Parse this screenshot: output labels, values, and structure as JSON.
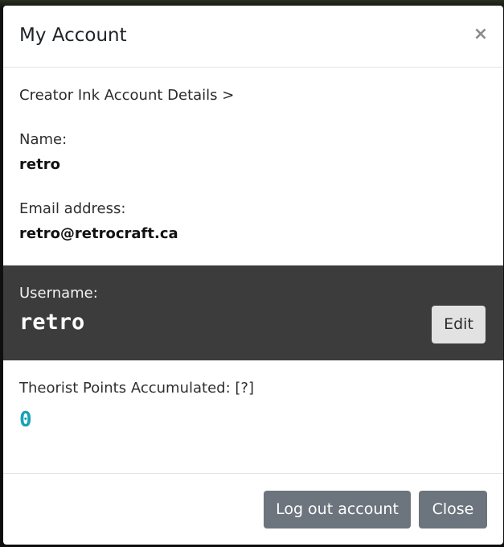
{
  "modal": {
    "title": "My Account",
    "close_icon": "×"
  },
  "details_link": "Creator Ink Account Details >",
  "fields": {
    "name_label": "Name:",
    "name_value": "retro",
    "email_label": "Email address:",
    "email_value": "retro@retrocraft.ca"
  },
  "username": {
    "label": "Username:",
    "value": "retro",
    "edit_label": "Edit"
  },
  "points": {
    "label": "Theorist Points Accumulated:",
    "help": "[?]",
    "value": "0"
  },
  "footer": {
    "logout_label": "Log out account",
    "close_label": "Close"
  },
  "colors": {
    "username_band": "#3c3c3c",
    "points_accent": "#17a2b8",
    "secondary_button": "#6c757d",
    "edit_button": "#e2e2e2"
  }
}
